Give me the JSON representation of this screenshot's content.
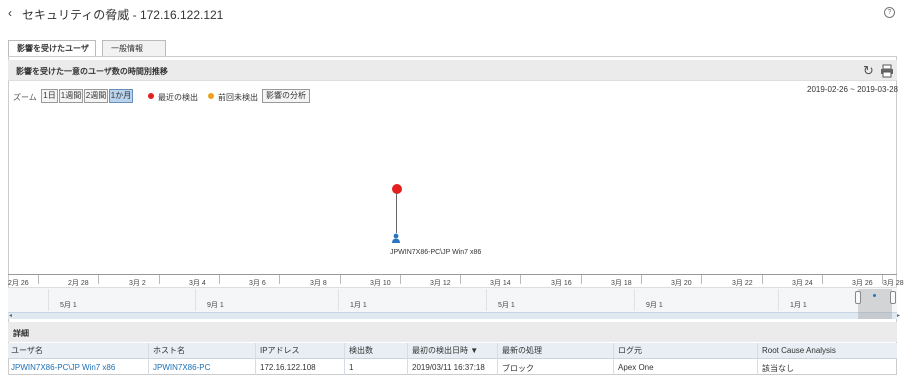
{
  "header": {
    "back_icon": "chevron-left-icon",
    "title": "セキュリティの脅威 - 172.16.122.121",
    "help_icon": "help-circle-icon"
  },
  "tabs": [
    {
      "label": "影響を受けたユーザ",
      "active": true
    },
    {
      "label": "一般情報",
      "active": false
    }
  ],
  "section": {
    "title": "影響を受けた一意のユーザ数の時間別推移",
    "refresh_icon": "refresh-icon",
    "print_icon": "print-icon"
  },
  "toolbar": {
    "zoom_label": "ズーム",
    "zoom_options": [
      {
        "label": "1日",
        "active": false
      },
      {
        "label": "1週間",
        "active": false
      },
      {
        "label": "2週間",
        "active": false
      },
      {
        "label": "1か月",
        "active": true
      }
    ],
    "legend": [
      {
        "label": "最近の検出",
        "color": "#e51e1e"
      },
      {
        "label": "前回未検出",
        "color": "#f0a020"
      }
    ],
    "impact_button": "影響の分析",
    "date_range": "2019-02-26 ~ 2019-03-28"
  },
  "timeline": {
    "node_color": "#e51e1e",
    "user_icon": "user-icon",
    "host_label": "JPWIN7X86-PC\\JP Win7 x86",
    "ticks": [
      "2月 26",
      "2月 28",
      "3月 2",
      "3月 4",
      "3月 6",
      "3月 8",
      "3月 10",
      "3月 12",
      "3月 14",
      "3月 16",
      "3月 18",
      "3月 20",
      "3月 22",
      "3月 24",
      "3月 26",
      "3月 28"
    ],
    "overview_labels": [
      "5月 1",
      "9月 1",
      "1月 1",
      "5月 1",
      "9月 1",
      "1月 1"
    ]
  },
  "details": {
    "title": "詳細",
    "columns": [
      "ユーザ名",
      "ホスト名",
      "IPアドレス",
      "検出数",
      "最初の検出日時 ▼",
      "最新の処理",
      "ログ元",
      "Root Cause Analysis"
    ],
    "rows": [
      [
        "JPWIN7X86-PC\\JP Win7 x86",
        "JPWIN7X86-PC",
        "172.16.122.108",
        "1",
        "2019/03/11 16:37:18",
        "ブロック",
        "Apex One",
        "該当なし"
      ]
    ]
  }
}
